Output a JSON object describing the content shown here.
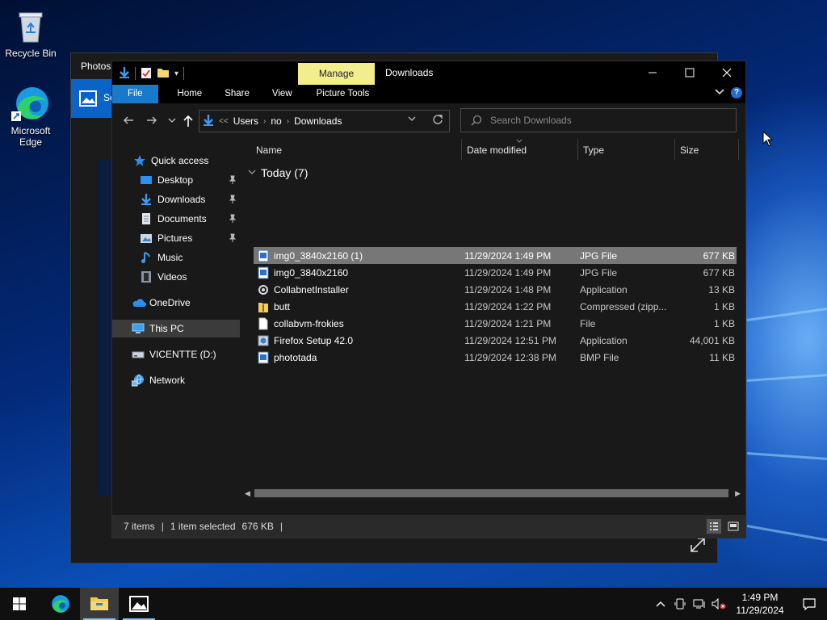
{
  "desktop": {
    "icons": [
      {
        "label": "Recycle Bin"
      },
      {
        "label": "Microsoft Edge"
      }
    ]
  },
  "photos_window": {
    "title": "Photos",
    "partial_text": "Se"
  },
  "explorer": {
    "title": "Downloads",
    "manage_tab": "Manage",
    "ribbon_tabs": [
      "File",
      "Home",
      "Share",
      "View",
      "Picture Tools"
    ],
    "address": {
      "overflow": "<<",
      "parts": [
        "Users",
        "no",
        "Downloads"
      ]
    },
    "search_placeholder": "Search Downloads",
    "nav_pane": {
      "quick_access": "Quick access",
      "pinned": [
        "Desktop",
        "Downloads",
        "Documents",
        "Pictures"
      ],
      "unpinned": [
        "Music",
        "Videos"
      ],
      "onedrive": "OneDrive",
      "this_pc": "This PC",
      "drive": "VICENTTE (D:)",
      "network": "Network"
    },
    "columns": [
      "Name",
      "Date modified",
      "Type",
      "Size"
    ],
    "group": "Today (7)",
    "files": [
      {
        "name": "img0_3840x2160 (1)",
        "date": "11/29/2024 1:49 PM",
        "type": "JPG File",
        "size": "677 KB",
        "icon": "image-file-icon"
      },
      {
        "name": "img0_3840x2160",
        "date": "11/29/2024 1:49 PM",
        "type": "JPG File",
        "size": "677 KB",
        "icon": "image-file-icon"
      },
      {
        "name": "CollabnetInstaller",
        "date": "11/29/2024 1:48 PM",
        "type": "Application",
        "size": "13 KB",
        "icon": "app-file-icon"
      },
      {
        "name": "butt",
        "date": "11/29/2024 1:22 PM",
        "type": "Compressed (zipp...",
        "size": "1 KB",
        "icon": "zip-file-icon"
      },
      {
        "name": "collabvm-frokies",
        "date": "11/29/2024 1:21 PM",
        "type": "File",
        "size": "1 KB",
        "icon": "blank-file-icon"
      },
      {
        "name": "Firefox Setup 42.0",
        "date": "11/29/2024 12:51 PM",
        "type": "Application",
        "size": "44,001 KB",
        "icon": "installer-file-icon"
      },
      {
        "name": "phototada",
        "date": "11/29/2024 12:38 PM",
        "type": "BMP File",
        "size": "11 KB",
        "icon": "image-file-icon"
      }
    ],
    "status": {
      "items": "7 items",
      "selected": "1 item selected",
      "size": "676 KB",
      "trailing": "|"
    }
  },
  "taskbar": {
    "time": "1:49 PM",
    "date": "11/29/2024"
  }
}
